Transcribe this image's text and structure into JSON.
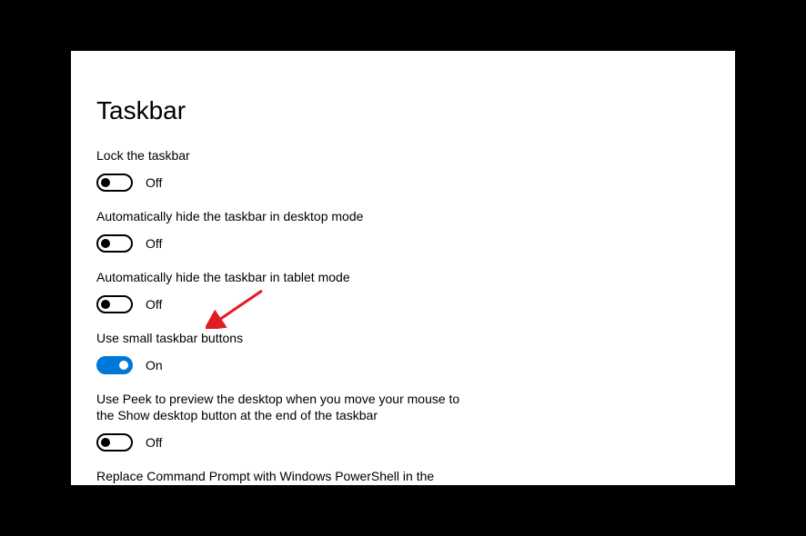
{
  "title": "Taskbar",
  "settings": [
    {
      "label": "Lock the taskbar",
      "state": "Off",
      "on": false
    },
    {
      "label": "Automatically hide the taskbar in desktop mode",
      "state": "Off",
      "on": false
    },
    {
      "label": "Automatically hide the taskbar in tablet mode",
      "state": "Off",
      "on": false
    },
    {
      "label": "Use small taskbar buttons",
      "state": "On",
      "on": true
    },
    {
      "label": "Use Peek to preview the desktop when you move your mouse to the Show desktop button at the end of the taskbar",
      "state": "Off",
      "on": false
    },
    {
      "label": "Replace Command Prompt with Windows PowerShell in the menu when I right-click the start button or press Windows key+X",
      "state": "",
      "on": false,
      "truncated": true
    }
  ],
  "arrow_color": "#e31b23"
}
